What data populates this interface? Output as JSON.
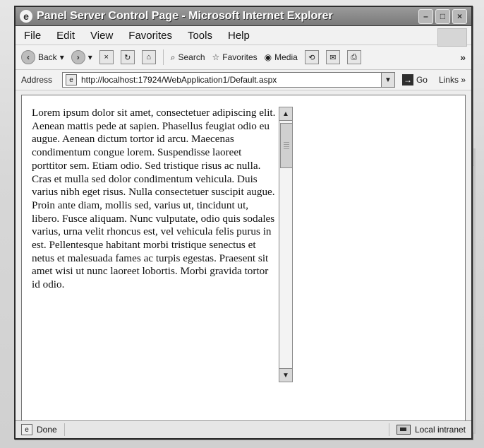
{
  "window": {
    "title": "Panel Server Control Page - Microsoft Internet Explorer",
    "icon": "ie-logo-icon"
  },
  "menu": {
    "items": [
      "File",
      "Edit",
      "View",
      "Favorites",
      "Tools",
      "Help"
    ]
  },
  "toolbar": {
    "back_label": "Back",
    "search_label": "Search",
    "favorites_label": "Favorites",
    "media_label": "Media",
    "more_label": "»"
  },
  "address": {
    "label": "Address",
    "value": "http://localhost:17924/WebApplication1/Default.aspx",
    "go_label": "Go",
    "links_label": "Links",
    "links_more": "»"
  },
  "page": {
    "text": "Lorem ipsum dolor sit amet, consectetuer adipiscing elit. Aenean mattis pede at sapien. Phasellus feugiat odio eu augue. Aenean dictum tortor id arcu. Maecenas condimentum congue lorem. Suspendisse laoreet porttitor sem. Etiam odio. Sed tristique risus ac nulla. Cras et mulla sed dolor condimentum vehicula. Duis varius nibh eget risus. Nulla consectetuer suscipit augue. Proin ante diam, mollis sed, varius ut, tincidunt ut, libero. Fusce aliquam. Nunc vulputate, odio quis sodales varius, urna velit rhoncus est, vel vehicula felis purus in est. Pellentesque habitant morbi tristique senectus et netus et malesuada fames ac turpis egestas. Praesent sit amet wisi ut nunc laoreet lobortis. Morbi gravida tortor id odio."
  },
  "status": {
    "left_text": "Done",
    "right_text": "Local intranet"
  }
}
